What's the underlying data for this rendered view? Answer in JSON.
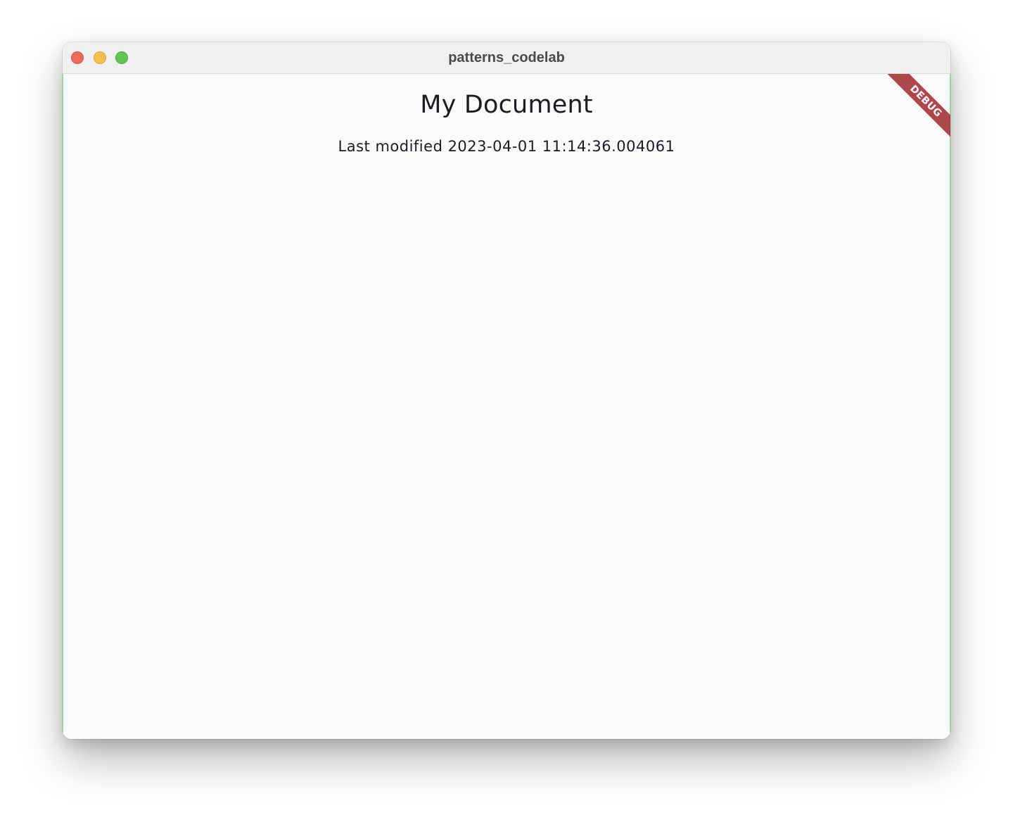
{
  "window": {
    "title": "patterns_codelab"
  },
  "document": {
    "title": "My Document",
    "last_modified": "Last modified 2023-04-01 11:14:36.004061"
  },
  "debug_banner": {
    "label": "DEBUG"
  },
  "colors": {
    "traffic_close": "#ed6a5e",
    "traffic_minimize": "#f5bf4f",
    "traffic_maximize": "#61c554",
    "debug_ribbon": "#a0282c",
    "content_background": "#fcfafd"
  }
}
